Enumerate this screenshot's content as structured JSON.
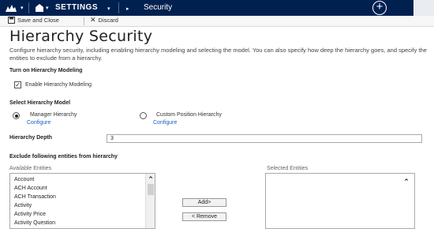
{
  "nav": {
    "settings_label": "SETTINGS",
    "breadcrumb": "Security",
    "plus_glyph": "+"
  },
  "commands": {
    "save_close_label": "Save and Close",
    "discard_label": "Discard"
  },
  "page": {
    "title": "Hierarchy Security",
    "description": "Configure hierarchy security, including enabling hierarchy modeling and selecting the model. You can also specify how deep the hierarchy goes, and specify the entities to exclude from a hierarchy."
  },
  "turn_on": {
    "heading": "Turn on Hierarchy Modeling",
    "checkbox_label": "Enable Hierarchy Modeling",
    "checked": true
  },
  "model": {
    "heading": "Select Hierarchy Model",
    "option1_label": "Manager Hierarchy",
    "option1_link": "Configure",
    "option2_label": "Custom Position Hierarchy",
    "option2_link": "Configure",
    "selected": "Manager Hierarchy"
  },
  "depth": {
    "label": "Hierarchy Depth",
    "value": "3"
  },
  "exclude": {
    "heading": "Exclude following entities from hierarchy",
    "available_label": "Available Entities",
    "selected_label": "Selected Entities",
    "available_items": [
      "Account",
      "ACH Account",
      "ACH Transaction",
      "Activity",
      "Activity Price",
      "Activity Question"
    ],
    "add_label": "Add>",
    "remove_label": "< Remove"
  },
  "icons": {
    "logo": "dynamics-logo-icon",
    "save": "save-icon",
    "discard": "discard-icon",
    "new": "plus-circle-icon",
    "scroll_up": "chevron-up-icon"
  },
  "colors": {
    "nav_bg": "#002050",
    "link": "#1560bd"
  }
}
